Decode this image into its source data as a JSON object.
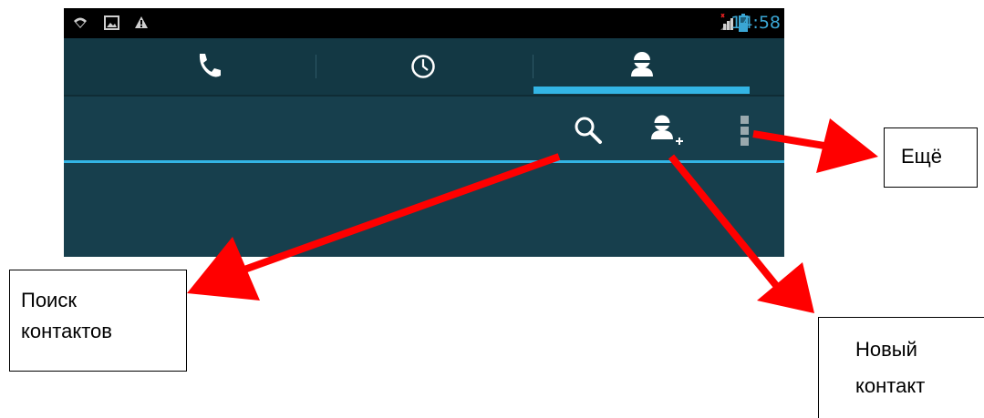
{
  "statusbar": {
    "time": "14:58",
    "icons": [
      "wifi-icon",
      "image-notification-icon",
      "warning-icon",
      "signal-icon",
      "battery-icon"
    ]
  },
  "tabs": [
    {
      "id": "phone",
      "icon": "phone-icon"
    },
    {
      "id": "recent",
      "icon": "clock-icon"
    },
    {
      "id": "contacts",
      "icon": "contact-person-icon",
      "selected": true
    }
  ],
  "actionbar": {
    "actions": [
      {
        "id": "search",
        "icon": "search-icon"
      },
      {
        "id": "add-contact",
        "icon": "add-contact-icon"
      },
      {
        "id": "more",
        "icon": "overflow-menu-icon"
      }
    ]
  },
  "annotations": {
    "more": {
      "text": "Ещё"
    },
    "search": {
      "line1": "Поиск",
      "line2": "контактов"
    },
    "new_contact": {
      "line1": "Новый",
      "line2": "контакт"
    }
  },
  "colors": {
    "statusbar_bg": "#000000",
    "app_bg": "#173f4d",
    "accent": "#33b5e5",
    "icon": "#ffffff",
    "arrow": "#ff0000"
  }
}
